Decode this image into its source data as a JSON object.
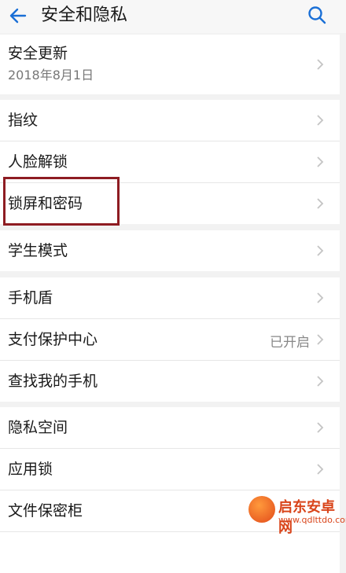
{
  "header": {
    "title": "安全和隐私"
  },
  "groups": [
    {
      "items": [
        {
          "label": "安全更新",
          "sub": "2018年8月1日"
        }
      ]
    },
    {
      "items": [
        {
          "label": "指纹"
        },
        {
          "label": "人脸解锁"
        },
        {
          "label": "锁屏和密码"
        }
      ]
    },
    {
      "items": [
        {
          "label": "学生模式"
        }
      ]
    },
    {
      "items": [
        {
          "label": "手机盾"
        },
        {
          "label": "支付保护中心",
          "value": "已开启"
        },
        {
          "label": "查找我的手机"
        }
      ]
    },
    {
      "items": [
        {
          "label": "隐私空间"
        },
        {
          "label": "应用锁"
        },
        {
          "label": "文件保密柜"
        },
        {
          "label": ""
        }
      ]
    }
  ],
  "watermark": {
    "title": "启东安卓网",
    "url": "www.qdlttdo.com"
  },
  "colors": {
    "highlight": "#8e1c22",
    "accent": "#1a73e8"
  }
}
